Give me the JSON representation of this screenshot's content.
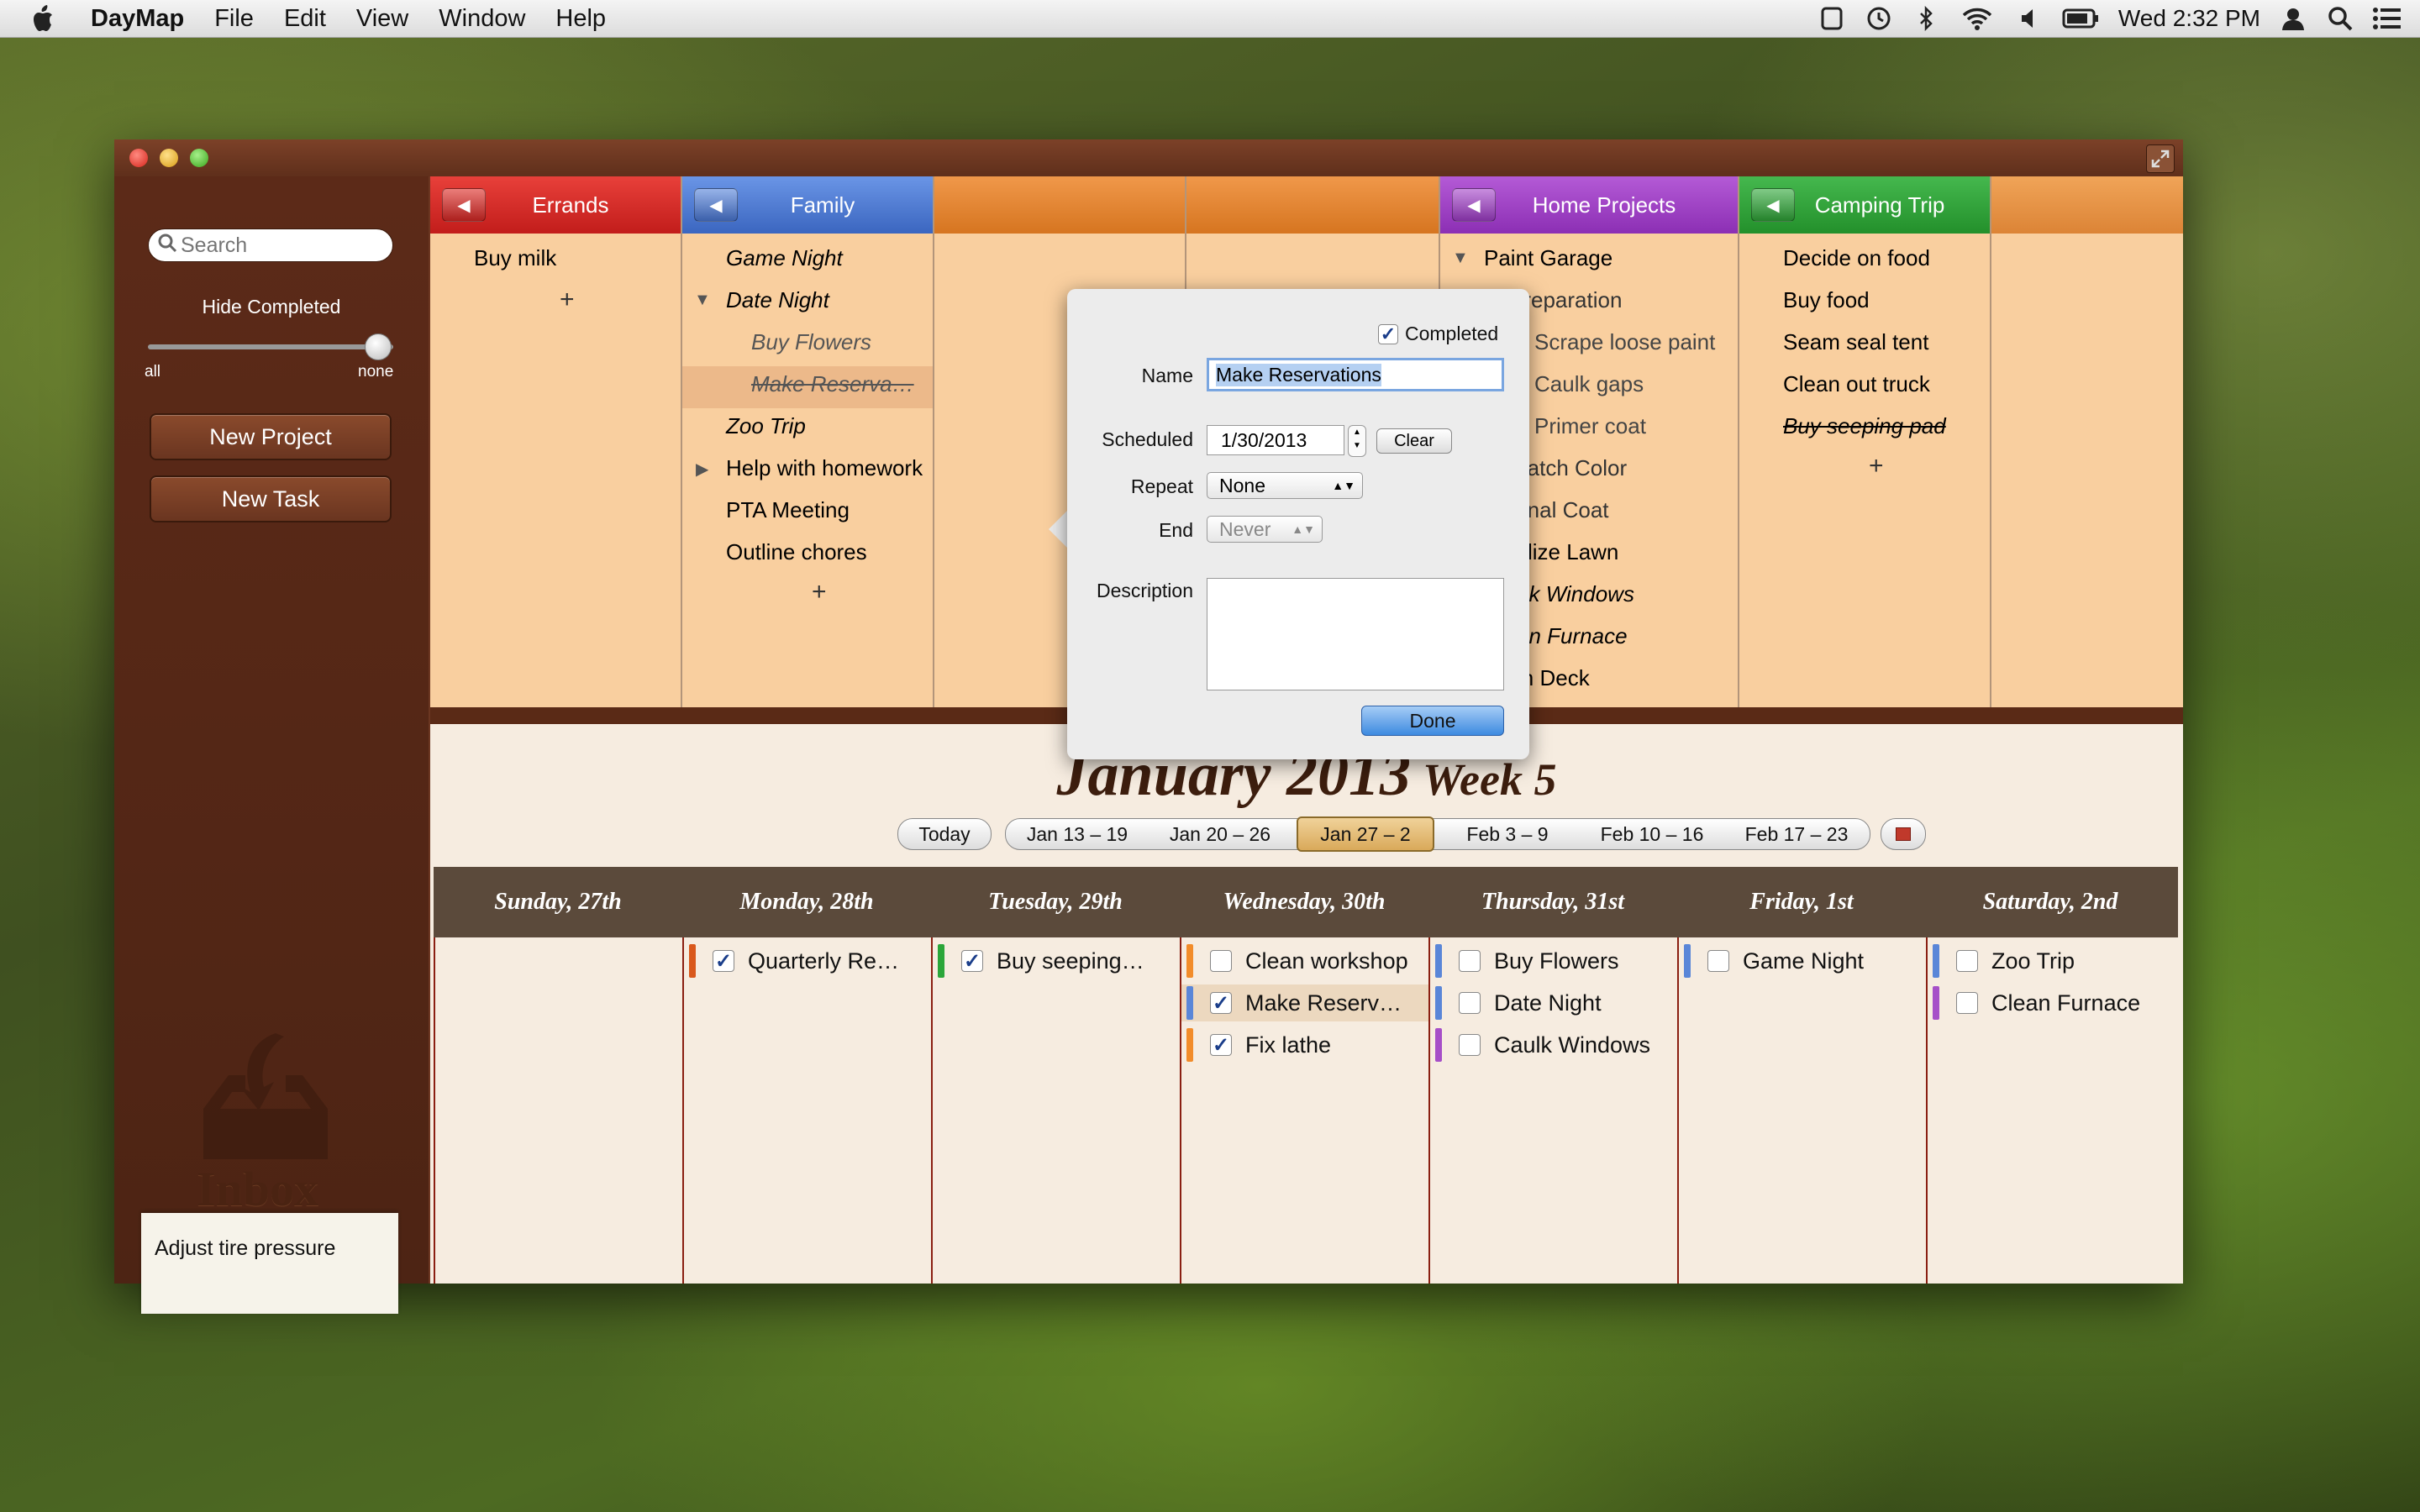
{
  "menubar": {
    "app_name": "DayMap",
    "items": [
      "File",
      "Edit",
      "View",
      "Window",
      "Help"
    ],
    "clock": "Wed 2:32 PM",
    "status_icons": [
      "screen-icon",
      "time-machine-icon",
      "bluetooth-icon",
      "wifi-icon",
      "volume-icon",
      "battery-icon",
      "user-icon",
      "spotlight-icon",
      "notification-list-icon"
    ]
  },
  "sidebar": {
    "search_placeholder": "Search",
    "hide_completed_label": "Hide Completed",
    "slider_min_label": "all",
    "slider_max_label": "none",
    "slider_value": 1.0,
    "new_project_label": "New Project",
    "new_task_label": "New Task",
    "inbox_label": "Inbox",
    "inbox_note": "Adjust tire pressure"
  },
  "projects": {
    "add_symbol": "+",
    "columns": [
      {
        "title": "Errands",
        "color": "#d6282a",
        "tasks": [
          "Buy milk"
        ]
      },
      {
        "title": "Family",
        "color": "#4a76cc",
        "tasks": [
          "Game Night",
          "Date Night",
          "Buy Flowers",
          "Make Reserva…",
          "Zoo Trip",
          "Help with homework",
          "PTA Meeting",
          "Outline chores"
        ]
      },
      {
        "title": "Home Projects",
        "color": "#9a3fc0",
        "tasks": [
          "Paint Garage",
          "Preparation",
          "Scrape loose paint",
          "Caulk gaps",
          "Primer coat",
          "Match Color",
          "Final Coat",
          "Fertilize Lawn",
          "Caulk Windows",
          "Clean Furnace",
          "Stain Deck"
        ]
      },
      {
        "title": "Camping Trip",
        "color": "#2c9a35",
        "tasks": [
          "Decide on food",
          "Buy food",
          "Seam seal tent",
          "Clean out truck",
          "Buy seeping pad"
        ]
      }
    ],
    "hidden_column_colors": [
      "#e0852a",
      "#e0852a",
      "#e7963f"
    ]
  },
  "calendar": {
    "month_title": "January 2013",
    "week_title": "Week 5",
    "today_label": "Today",
    "weeks": [
      "Jan 13 – 19",
      "Jan 20 – 26",
      "Jan 27 – 2",
      "Feb 3 – 9",
      "Feb 10 – 16",
      "Feb 17 – 23"
    ],
    "selected_week": "Jan 27 – 2",
    "days": [
      {
        "name": "Sunday, 27th",
        "tasks": []
      },
      {
        "name": "Monday, 28th",
        "tasks": [
          {
            "label": "Quarterly Re…",
            "color": "#d9581c",
            "checked": true
          }
        ]
      },
      {
        "name": "Tuesday, 29th",
        "tasks": [
          {
            "label": "Buy seeping…",
            "color": "#2ba63a",
            "checked": true
          }
        ]
      },
      {
        "name": "Wednesday, 30th",
        "tasks": [
          {
            "label": "Clean workshop",
            "color": "#f28c2a",
            "checked": false
          },
          {
            "label": "Make Reserv…",
            "color": "#5a86d8",
            "checked": true,
            "selected": true
          },
          {
            "label": "Fix lathe",
            "color": "#f28c2a",
            "checked": true
          }
        ]
      },
      {
        "name": "Thursday, 31st",
        "tasks": [
          {
            "label": "Buy Flowers",
            "color": "#5a86d8",
            "checked": false
          },
          {
            "label": "Date Night",
            "color": "#5a86d8",
            "checked": false
          },
          {
            "label": "Caulk Windows",
            "color": "#a64fc8",
            "checked": false
          }
        ]
      },
      {
        "name": "Friday, 1st",
        "tasks": [
          {
            "label": "Game Night",
            "color": "#5a86d8",
            "checked": false
          }
        ]
      },
      {
        "name": "Saturday, 2nd",
        "tasks": [
          {
            "label": "Zoo Trip",
            "color": "#5a86d8",
            "checked": false
          },
          {
            "label": "Clean Furnace",
            "color": "#a64fc8",
            "checked": false
          }
        ]
      }
    ]
  },
  "popover": {
    "completed_label": "Completed",
    "completed_checked": true,
    "name_label": "Name",
    "name_value": "Make Reservations",
    "scheduled_label": "Scheduled",
    "scheduled_value": "1/30/2013",
    "clear_label": "Clear",
    "repeat_label": "Repeat",
    "repeat_value": "None",
    "end_label": "End",
    "end_value": "Never",
    "description_label": "Description",
    "description_value": "",
    "done_label": "Done"
  }
}
